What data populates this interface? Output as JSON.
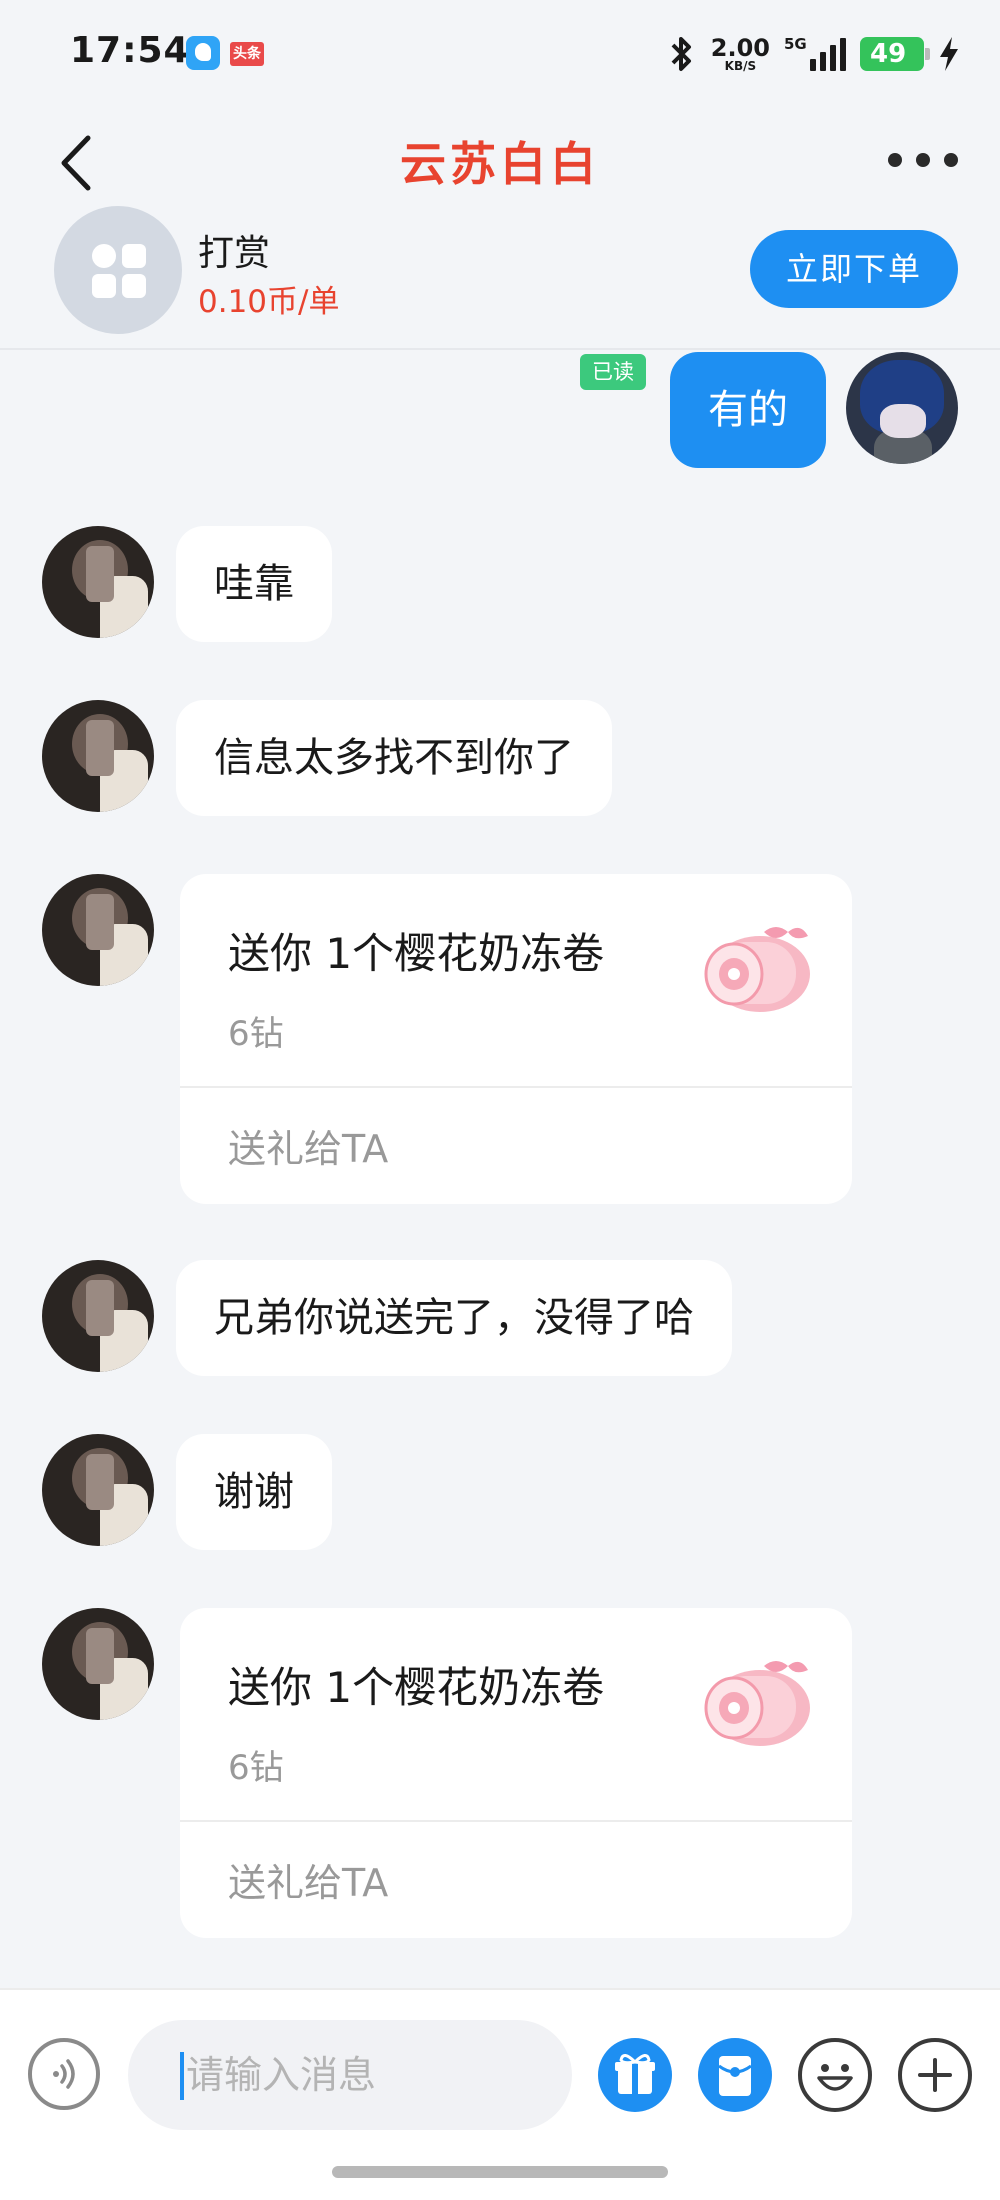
{
  "status_bar": {
    "time": "17:54",
    "badge": "头条",
    "net_speed": "2.00",
    "net_unit": "KB/S",
    "network": "5G",
    "battery": "49"
  },
  "nav": {
    "title": "云苏白白"
  },
  "service": {
    "name": "打赏",
    "price": "0.10币/单",
    "order_button": "立即下单"
  },
  "messages": {
    "m1": {
      "text": "有的",
      "read": "已读"
    },
    "m2": {
      "text": "哇靠"
    },
    "m3": {
      "text": "信息太多找不到你了"
    },
    "m4": {
      "title": "送你 1个樱花奶冻卷",
      "price": "6钻",
      "action": "送礼给TA"
    },
    "m5": {
      "text": "兄弟你说送完了，没得了哈"
    },
    "m6": {
      "text": "谢谢"
    },
    "m7": {
      "title": "送你 1个樱花奶冻卷",
      "price": "6钻",
      "action": "送礼给TA"
    }
  },
  "input": {
    "placeholder": "请输入消息"
  },
  "colors": {
    "accent": "#1e8ff2",
    "title_red": "#e8432f",
    "read_green": "#3cc97d",
    "background": "#f3f5f8"
  },
  "icons": {
    "back": "chevron-left-icon",
    "more": "more-dots-icon",
    "voice": "voice-icon",
    "gift": "gift-icon",
    "red_packet": "red-packet-icon",
    "emoji": "emoji-icon",
    "plus": "plus-icon"
  }
}
